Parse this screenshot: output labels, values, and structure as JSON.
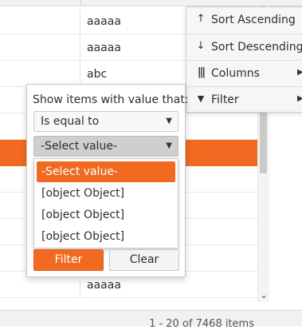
{
  "grid": {
    "rows": [
      {
        "value": "aaaaa",
        "selected": false
      },
      {
        "value": "aaaaa",
        "selected": false
      },
      {
        "value": "abc",
        "selected": false
      },
      {
        "value": "",
        "selected": false
      },
      {
        "value": "",
        "selected": false
      },
      {
        "value": "",
        "selected": true
      },
      {
        "value": "",
        "selected": false
      },
      {
        "value": "",
        "selected": false
      },
      {
        "value": "",
        "selected": false
      },
      {
        "value": "",
        "selected": false
      },
      {
        "value": "aaaaa",
        "selected": false
      }
    ],
    "pager_info": "1 - 20 of 7468 items"
  },
  "column_menu": {
    "items": [
      {
        "name": "sort-ascending",
        "icon": "arrow-up-icon",
        "glyph": "↑",
        "label": "Sort Ascending",
        "submenu": false
      },
      {
        "name": "sort-descending",
        "icon": "arrow-down-icon",
        "glyph": "↓",
        "label": "Sort Descending",
        "submenu": false
      },
      {
        "name": "columns",
        "icon": "columns-icon",
        "glyph": "|||",
        "label": "Columns",
        "submenu": true
      },
      {
        "name": "filter",
        "icon": "filter-funnel-icon",
        "glyph": "▼",
        "label": "Filter",
        "submenu": true
      }
    ]
  },
  "filter_popup": {
    "title": "Show items with value that:",
    "operator": "Is equal to",
    "value_placeholder": "-Select value-",
    "options": [
      "-Select value-",
      "[object Object]",
      "[object Object]",
      "[object Object]"
    ],
    "selected_option_index": 0,
    "filter_label": "Filter",
    "clear_label": "Clear"
  },
  "colors": {
    "accent": "#f26a21",
    "menu_bg": "#f6f6f6",
    "header_bg": "#f1f1f1"
  }
}
